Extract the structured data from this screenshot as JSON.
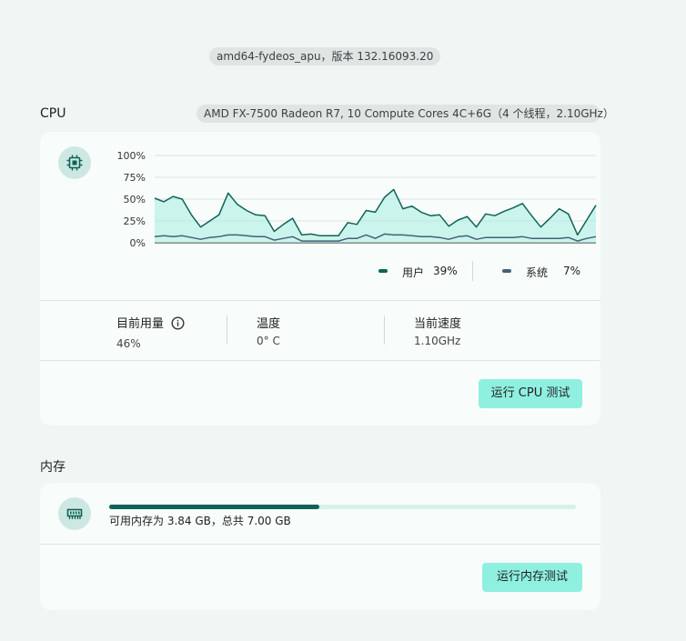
{
  "header": {
    "version_text": "amd64-fydeos_apu，版本 132.16093.20"
  },
  "cpu": {
    "title": "CPU",
    "processor": "AMD FX-7500 Radeon R7, 10 Compute Cores 4C+6G（4 个线程，2.10GHz）",
    "icon": "cpu-chip-icon",
    "legend": {
      "user_label": "用户",
      "user_value": "39%",
      "system_label": "系统",
      "system_value": "7%"
    },
    "stats": {
      "usage_label": "目前用量",
      "usage_value": "46%",
      "temp_label": "温度",
      "temp_value": "0° C",
      "speed_label": "当前速度",
      "speed_value": "1.10GHz"
    },
    "run_button": "运行 CPU 测试"
  },
  "memory": {
    "title": "内存",
    "icon": "memory-chip-icon",
    "text": "可用内存为 3.84 GB，总共 7.00 GB",
    "used_fraction": 0.451,
    "run_button": "运行内存测试"
  },
  "colors": {
    "accent": "#0e6356",
    "system": "#44607a",
    "button_bg": "#8ff0e0",
    "area_fill": "#a5ece0"
  },
  "chart_data": {
    "type": "area",
    "y_ticks": [
      "100%",
      "75%",
      "50%",
      "25%",
      "0%"
    ],
    "ylim": [
      0,
      100
    ],
    "grid": true,
    "legend_position": "bottom-right",
    "series": [
      {
        "name": "用户",
        "values": [
          51,
          47,
          53,
          50,
          32,
          18,
          25,
          32,
          57,
          44,
          37,
          32,
          31,
          13,
          21,
          28,
          9,
          10,
          8,
          8,
          8,
          23,
          21,
          37,
          35,
          52,
          61,
          39,
          42,
          35,
          31,
          32,
          19,
          26,
          30,
          18,
          33,
          31,
          36,
          40,
          45,
          31,
          18,
          28,
          39,
          33,
          9,
          26,
          43
        ]
      },
      {
        "name": "系统",
        "values": [
          7,
          8,
          7,
          8,
          6,
          4,
          6,
          7,
          9,
          9,
          8,
          7,
          7,
          3,
          5,
          7,
          2,
          2,
          2,
          2,
          2,
          5,
          5,
          9,
          5,
          10,
          9,
          9,
          8,
          7,
          7,
          6,
          4,
          7,
          8,
          4,
          6,
          6,
          6,
          6,
          7,
          5,
          5,
          5,
          5,
          6,
          2,
          5,
          7
        ]
      }
    ]
  }
}
